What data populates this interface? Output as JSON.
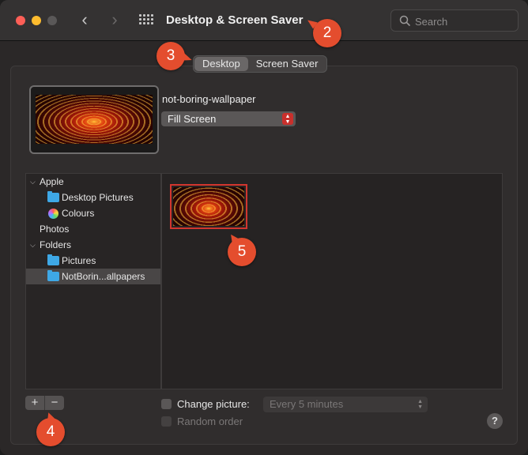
{
  "window": {
    "title": "Desktop & Screen Saver",
    "search_placeholder": "Search",
    "back_glyph": "‹",
    "forward_glyph": "›"
  },
  "tabs": [
    {
      "label": "Desktop",
      "active": true
    },
    {
      "label": "Screen Saver",
      "active": false
    }
  ],
  "current": {
    "wallpaper_name": "not-boring-wallpaper",
    "fill_mode": "Fill Screen"
  },
  "sources": [
    {
      "label": "Apple",
      "type": "group",
      "expanded": true
    },
    {
      "label": "Desktop Pictures",
      "type": "folder",
      "icon": "folder-icon"
    },
    {
      "label": "Colours",
      "type": "item",
      "icon": "colours-icon"
    },
    {
      "label": "Photos",
      "type": "group",
      "expanded": false
    },
    {
      "label": "Folders",
      "type": "group",
      "expanded": true
    },
    {
      "label": "Pictures",
      "type": "folder",
      "icon": "folder-icon"
    },
    {
      "label": "NotBorin...allpapers",
      "type": "folder",
      "icon": "folder-icon",
      "selected": true
    }
  ],
  "controls": {
    "add": "+",
    "remove": "−",
    "change_picture_label": "Change picture:",
    "change_picture_checked": false,
    "interval": "Every 5 minutes",
    "random_order_label": "Random order",
    "random_order_checked": false,
    "help": "?"
  },
  "badges": [
    "2",
    "3",
    "4",
    "5"
  ],
  "colors": {
    "accent_red": "#d2352e",
    "badge": "#e44d2e",
    "folder": "#3ea8e6"
  }
}
